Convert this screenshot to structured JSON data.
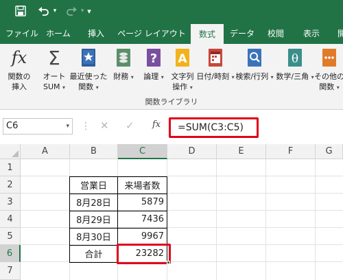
{
  "quick_access": {
    "icons": [
      "save-icon",
      "undo-icon",
      "redo-icon",
      "customize-icon"
    ],
    "customize_glyph": "▾"
  },
  "tabs": [
    "ファイル",
    "ホーム",
    "挿入",
    "ページ レイアウト",
    "数式",
    "データ",
    "校閲",
    "表示",
    "開発"
  ],
  "active_tab": "数式",
  "ribbon": {
    "buttons": [
      {
        "line1": "関数の",
        "line2": "挿入",
        "icon": "fx-icon"
      },
      {
        "line1": "オート",
        "line2": "SUM",
        "icon": "sigma-icon"
      },
      {
        "line1": "最近使った",
        "line2": "関数",
        "icon": "star-book-icon"
      },
      {
        "line1": "財務",
        "line2": "",
        "icon": "coins-book-icon"
      },
      {
        "line1": "論理",
        "line2": "",
        "icon": "question-book-icon"
      },
      {
        "line1": "文字列",
        "line2": "操作",
        "icon": "text-book-icon"
      },
      {
        "line1": "日付/時刻",
        "line2": "",
        "icon": "calendar-book-icon"
      },
      {
        "line1": "検索/行列",
        "line2": "",
        "icon": "search-book-icon"
      },
      {
        "line1": "数学/三角",
        "line2": "",
        "icon": "theta-book-icon"
      },
      {
        "line1": "その他の",
        "line2": "関数",
        "icon": "more-book-icon"
      }
    ],
    "group_label": "関数ライブラリ"
  },
  "formula_bar": {
    "name_box": "C6",
    "cancel_glyph": "✕",
    "enter_glyph": "✓",
    "fx_label": "fx",
    "formula": "=SUM(C3:C5)"
  },
  "grid": {
    "columns": [
      "A",
      "B",
      "C",
      "D",
      "E",
      "F",
      "G"
    ],
    "rows": [
      "1",
      "2",
      "3",
      "4",
      "5",
      "6",
      "7"
    ],
    "selected_column": "C",
    "selected_row": "6",
    "table": {
      "headers": [
        "営業日",
        "来場者数"
      ],
      "rows": [
        {
          "day": "8月28日",
          "count": "5879"
        },
        {
          "day": "8月29日",
          "count": "7436"
        },
        {
          "day": "8月30日",
          "count": "9967"
        }
      ],
      "total_label": "合計",
      "total_value": "23282"
    }
  },
  "colors": {
    "accent": "#217346",
    "highlight": "#e0001a"
  }
}
